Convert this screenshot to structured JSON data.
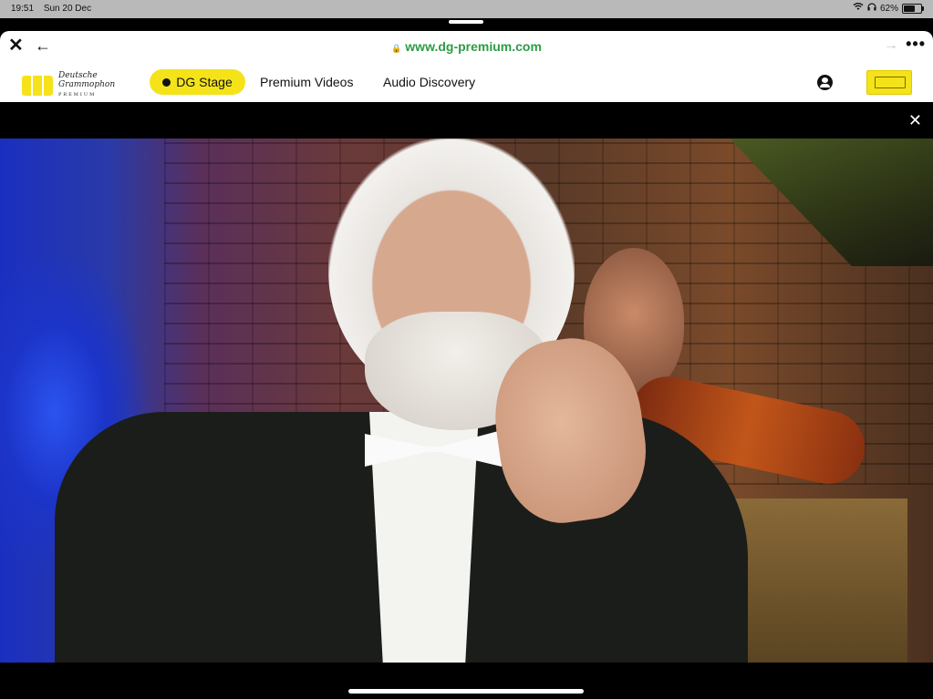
{
  "statusbar": {
    "time": "19:51",
    "date": "Sun 20 Dec",
    "battery": "62%",
    "battery_level": 0.62
  },
  "browser": {
    "url": "www.dg-premium.com"
  },
  "nav": {
    "brand_line1": "Deutsche",
    "brand_line2": "Grammophon",
    "brand_line3": "PREMIUM",
    "items": [
      {
        "label": "DG Stage",
        "active": true
      },
      {
        "label": "Premium Videos",
        "active": false
      },
      {
        "label": "Audio Discovery",
        "active": false
      }
    ]
  },
  "colors": {
    "accent": "#f4e319",
    "url_green": "#2d9c43"
  }
}
